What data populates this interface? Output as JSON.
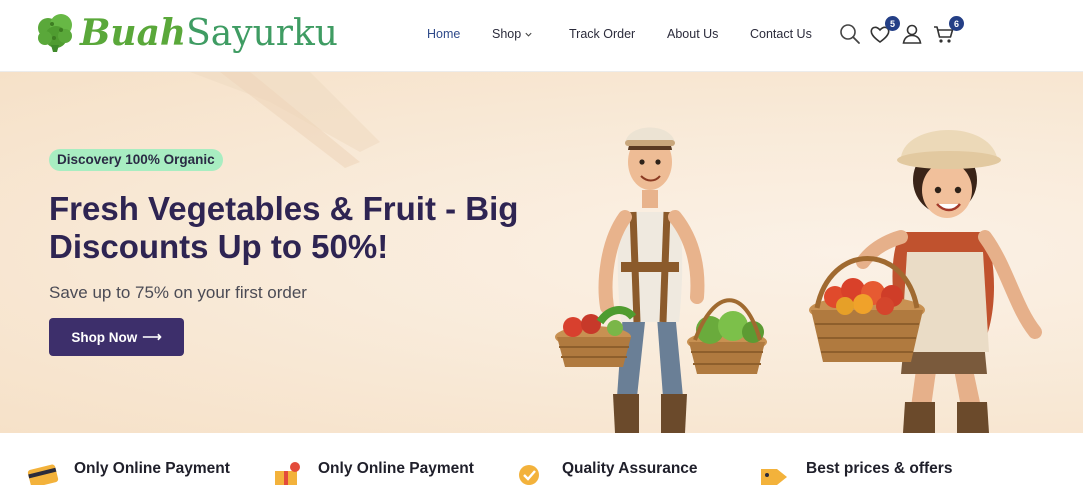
{
  "brand": {
    "name_part1": "Buah",
    "name_part2": "Sayurku",
    "logo_icon": "broccoli-icon",
    "colors": {
      "primary": "#5aa83a",
      "secondary": "#3f9c63"
    }
  },
  "nav": {
    "items": [
      {
        "label": "Home",
        "active": true
      },
      {
        "label": "Shop",
        "dropdown": true
      },
      {
        "label": "Track Order"
      },
      {
        "label": "About Us"
      },
      {
        "label": "Contact Us"
      }
    ]
  },
  "header_icons": {
    "search": {
      "icon": "search-icon"
    },
    "wishlist": {
      "icon": "heart-icon",
      "count": "5"
    },
    "account": {
      "icon": "user-icon"
    },
    "cart": {
      "icon": "cart-icon",
      "count": "6"
    }
  },
  "hero": {
    "tagline": "Discovery 100% Organic",
    "headline": "Fresh Vegetables & Fruit - Big Discounts Up to 50%!",
    "subheadline": "Save up to 75% on your first order",
    "cta_label": "Shop Now",
    "cta_arrow": "⟶",
    "colors": {
      "tag_bg": "#a8edc1",
      "heading": "#2e2452",
      "button": "#3d2f6b"
    }
  },
  "features": [
    {
      "title": "Only Online Payment",
      "icon": "credit-card-icon"
    },
    {
      "title": "Only Online Payment",
      "icon": "gift-icon"
    },
    {
      "title": "Quality Assurance",
      "icon": "quality-badge-icon"
    },
    {
      "title": "Best prices & offers",
      "icon": "price-tag-icon"
    }
  ]
}
